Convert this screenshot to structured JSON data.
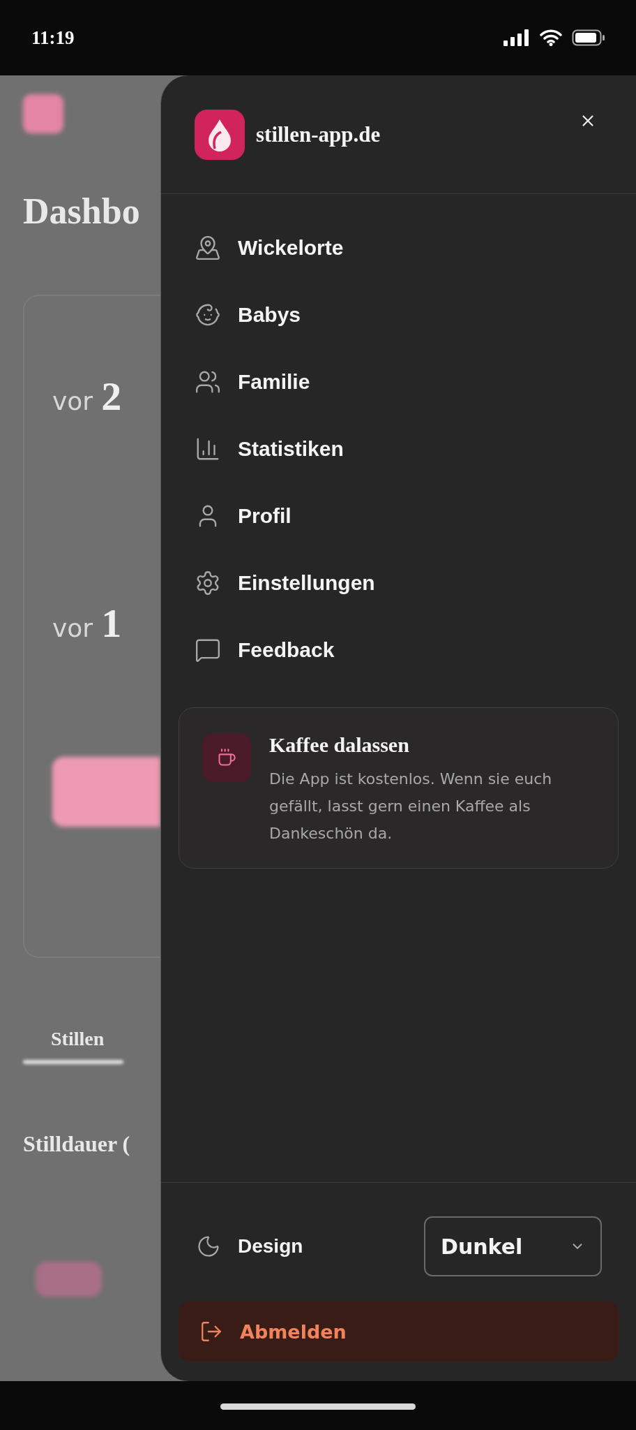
{
  "status_bar": {
    "time": "11:19"
  },
  "background": {
    "title": "Dashbo",
    "stats": [
      {
        "prefix": "vor",
        "number": "2"
      },
      {
        "prefix": "vor",
        "number": "1"
      }
    ],
    "tab": "Stillen",
    "section_title": "Stilldauer ("
  },
  "drawer": {
    "brand": "stillen-app.de",
    "items": [
      {
        "label": "Wickelorte"
      },
      {
        "label": "Babys"
      },
      {
        "label": "Familie"
      },
      {
        "label": "Statistiken"
      },
      {
        "label": "Profil"
      },
      {
        "label": "Einstellungen"
      },
      {
        "label": "Feedback"
      }
    ],
    "card": {
      "title": "Kaffee dalassen",
      "text": "Die App ist kostenlos. Wenn sie euch gefällt, lasst gern einen Kaffee als Dankeschön da."
    },
    "design": {
      "label": "Design",
      "value": "Dunkel"
    },
    "logout": "Abmelden"
  }
}
